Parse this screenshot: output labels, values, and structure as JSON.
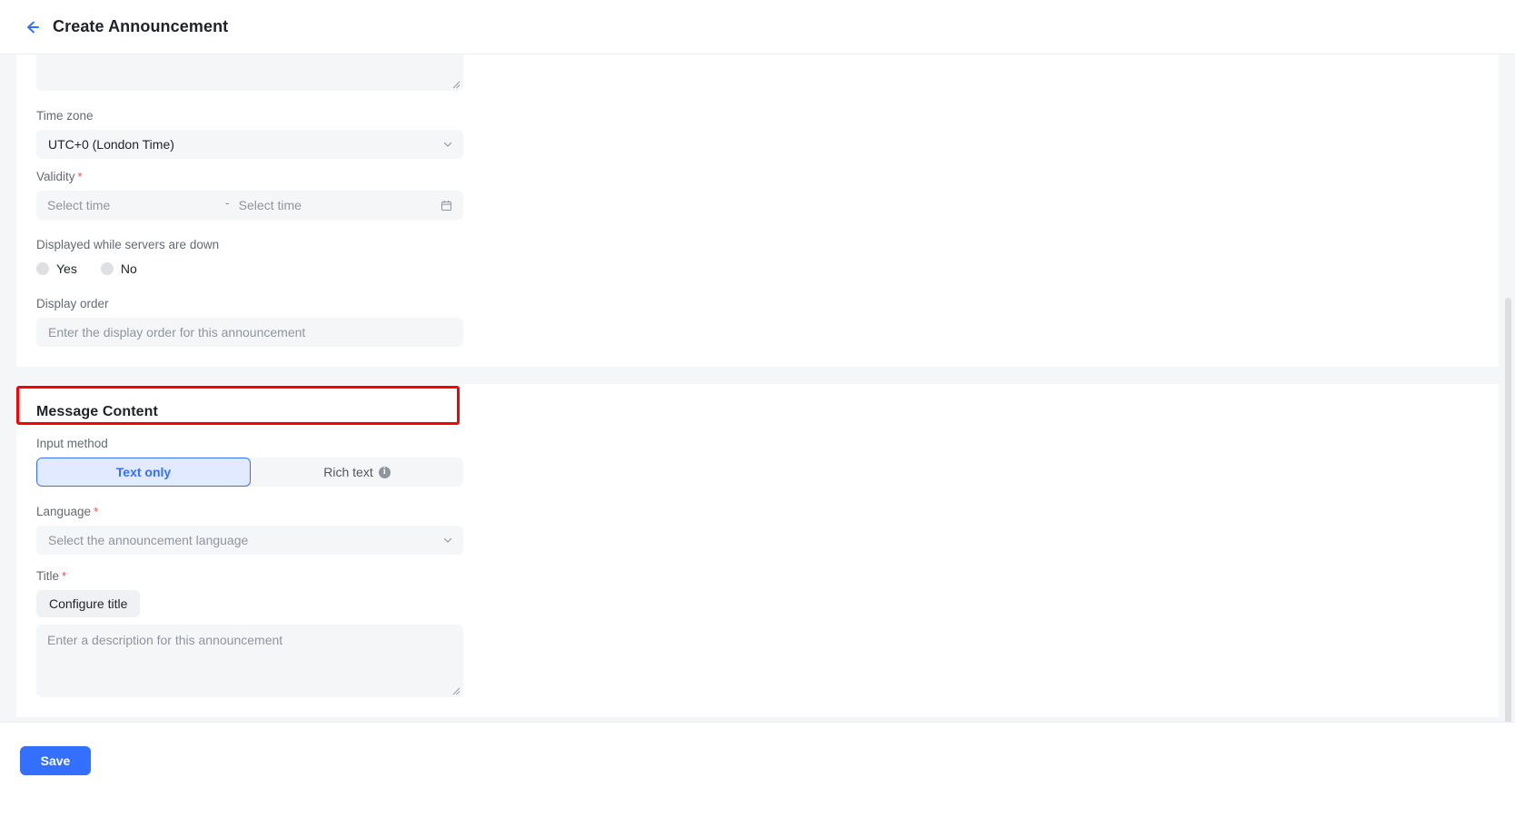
{
  "header": {
    "title": "Create Announcement",
    "back_icon": "arrow-left-icon"
  },
  "form": {
    "timezone": {
      "label": "Time zone",
      "value": "UTC+0 (London Time)",
      "chevron_icon": "chevron-down-icon"
    },
    "validity": {
      "label": "Validity",
      "required_mark": "*",
      "start_placeholder": "Select time",
      "end_placeholder": "Select time",
      "separator": "-",
      "calendar_icon": "calendar-icon"
    },
    "servers_down": {
      "label": "Displayed while servers are down",
      "options": [
        {
          "label": "Yes",
          "selected": false
        },
        {
          "label": "No",
          "selected": false
        }
      ]
    },
    "display_order": {
      "label": "Display order",
      "placeholder": "Enter the display order for this announcement",
      "value": "",
      "highlighted": true
    }
  },
  "message_content": {
    "section_title": "Message Content",
    "input_method": {
      "label": "Input method",
      "options": [
        {
          "label": "Text only",
          "selected": true
        },
        {
          "label": "Rich text",
          "selected": false,
          "info_icon": "info-icon",
          "info_glyph": "i"
        }
      ]
    },
    "language": {
      "label": "Language",
      "required_mark": "*",
      "placeholder": "Select the announcement language",
      "chevron_icon": "chevron-down-icon"
    },
    "title": {
      "label": "Title",
      "required_mark": "*",
      "configure_button": "Configure title",
      "description_placeholder": "Enter a description for this announcement"
    }
  },
  "footer": {
    "save_label": "Save"
  },
  "colors": {
    "accent": "#3370ff",
    "required": "#f54a45",
    "highlight": "#ff0000",
    "field_bg": "#f5f6f7",
    "text": "#1f2329",
    "muted": "#8f959e"
  }
}
